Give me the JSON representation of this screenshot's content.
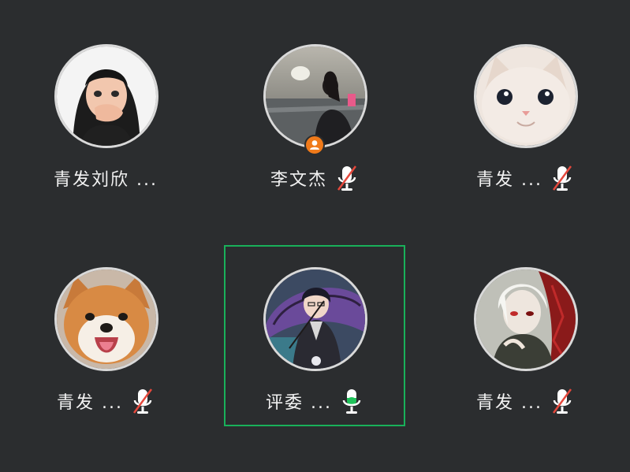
{
  "participants": [
    {
      "name": "青发刘欣 ...",
      "mic": "none",
      "avatar": "cartoon-girl-avatar",
      "host": false,
      "active": false
    },
    {
      "name": "李文杰",
      "mic": "muted",
      "avatar": "seaside-girl-avatar",
      "host": true,
      "active": false
    },
    {
      "name": "青发  ...",
      "mic": "muted",
      "avatar": "kitten-avatar",
      "host": false,
      "active": false
    },
    {
      "name": "青发  ...",
      "mic": "muted",
      "avatar": "shiba-dog-avatar",
      "host": false,
      "active": false
    },
    {
      "name": "评委 ...",
      "mic": "speaking",
      "avatar": "anime-boy-umbrella-avatar",
      "host": false,
      "active": true
    },
    {
      "name": "青发  ...",
      "mic": "muted",
      "avatar": "anime-white-hair-avatar",
      "host": false,
      "active": false
    }
  ],
  "colors": {
    "background": "#2b2d2f",
    "active_border": "#19b05a",
    "mute_slash": "#e5483c",
    "speaking": "#20c25a",
    "host_badge": "#f07a1a"
  }
}
